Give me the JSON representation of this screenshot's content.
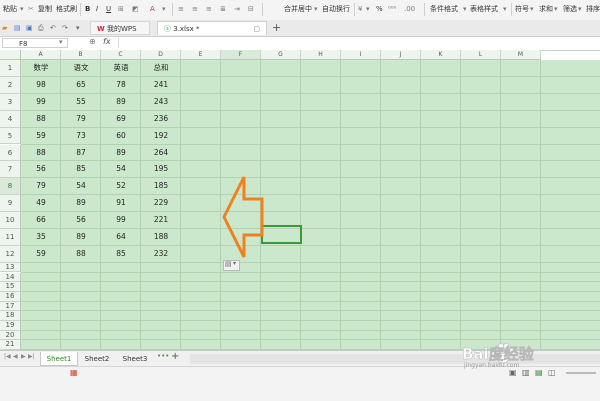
{
  "ribbon": {
    "paste": "粘贴",
    "copy": "复制",
    "format_painter": "格式刷",
    "bold": "B",
    "italic": "I",
    "underline": "U",
    "merge_center": "合并居中",
    "auto_wrap": "自动换行",
    "percent": "%",
    "conditional_format": "条件格式",
    "table_style": "表格样式",
    "symbol": "符号",
    "sum": "求和",
    "filter": "筛选",
    "sort": "排序"
  },
  "tabs": {
    "home": "我的WPS",
    "file": "3.xlsx *",
    "add": "+"
  },
  "formula_bar": {
    "name_box": "F8",
    "fx": "fx",
    "value": ""
  },
  "columns": [
    "A",
    "B",
    "C",
    "D",
    "E",
    "F",
    "G",
    "H",
    "I",
    "J",
    "K",
    "L",
    "M"
  ],
  "rows": [
    "1",
    "2",
    "3",
    "4",
    "5",
    "6",
    "7",
    "8",
    "9",
    "10",
    "11",
    "12",
    "13",
    "14",
    "15",
    "16",
    "17",
    "18",
    "19",
    "20",
    "21"
  ],
  "table": {
    "headers": [
      "数学",
      "语文",
      "英语",
      "总和"
    ],
    "rows": [
      [
        "98",
        "65",
        "78",
        "241"
      ],
      [
        "99",
        "55",
        "89",
        "243"
      ],
      [
        "88",
        "79",
        "69",
        "236"
      ],
      [
        "59",
        "73",
        "60",
        "192"
      ],
      [
        "88",
        "87",
        "89",
        "264"
      ],
      [
        "56",
        "85",
        "54",
        "195"
      ],
      [
        "79",
        "54",
        "52",
        "185"
      ],
      [
        "49",
        "89",
        "91",
        "229"
      ],
      [
        "66",
        "56",
        "99",
        "221"
      ],
      [
        "35",
        "89",
        "64",
        "188"
      ],
      [
        "59",
        "88",
        "85",
        "232"
      ]
    ]
  },
  "selected_cell": "F8",
  "paste_options_label": "▾",
  "sheets": [
    "Sheet1",
    "Sheet2",
    "Sheet3"
  ],
  "sheet_add": "+",
  "active_sheet": "Sheet1",
  "watermark": {
    "text": "Bai度经验",
    "url": "jingyan.baidu.com"
  },
  "colors": {
    "grid_bg": "#cce8cc",
    "selection": "#3c9a3c",
    "arrow": "#f0821e"
  }
}
